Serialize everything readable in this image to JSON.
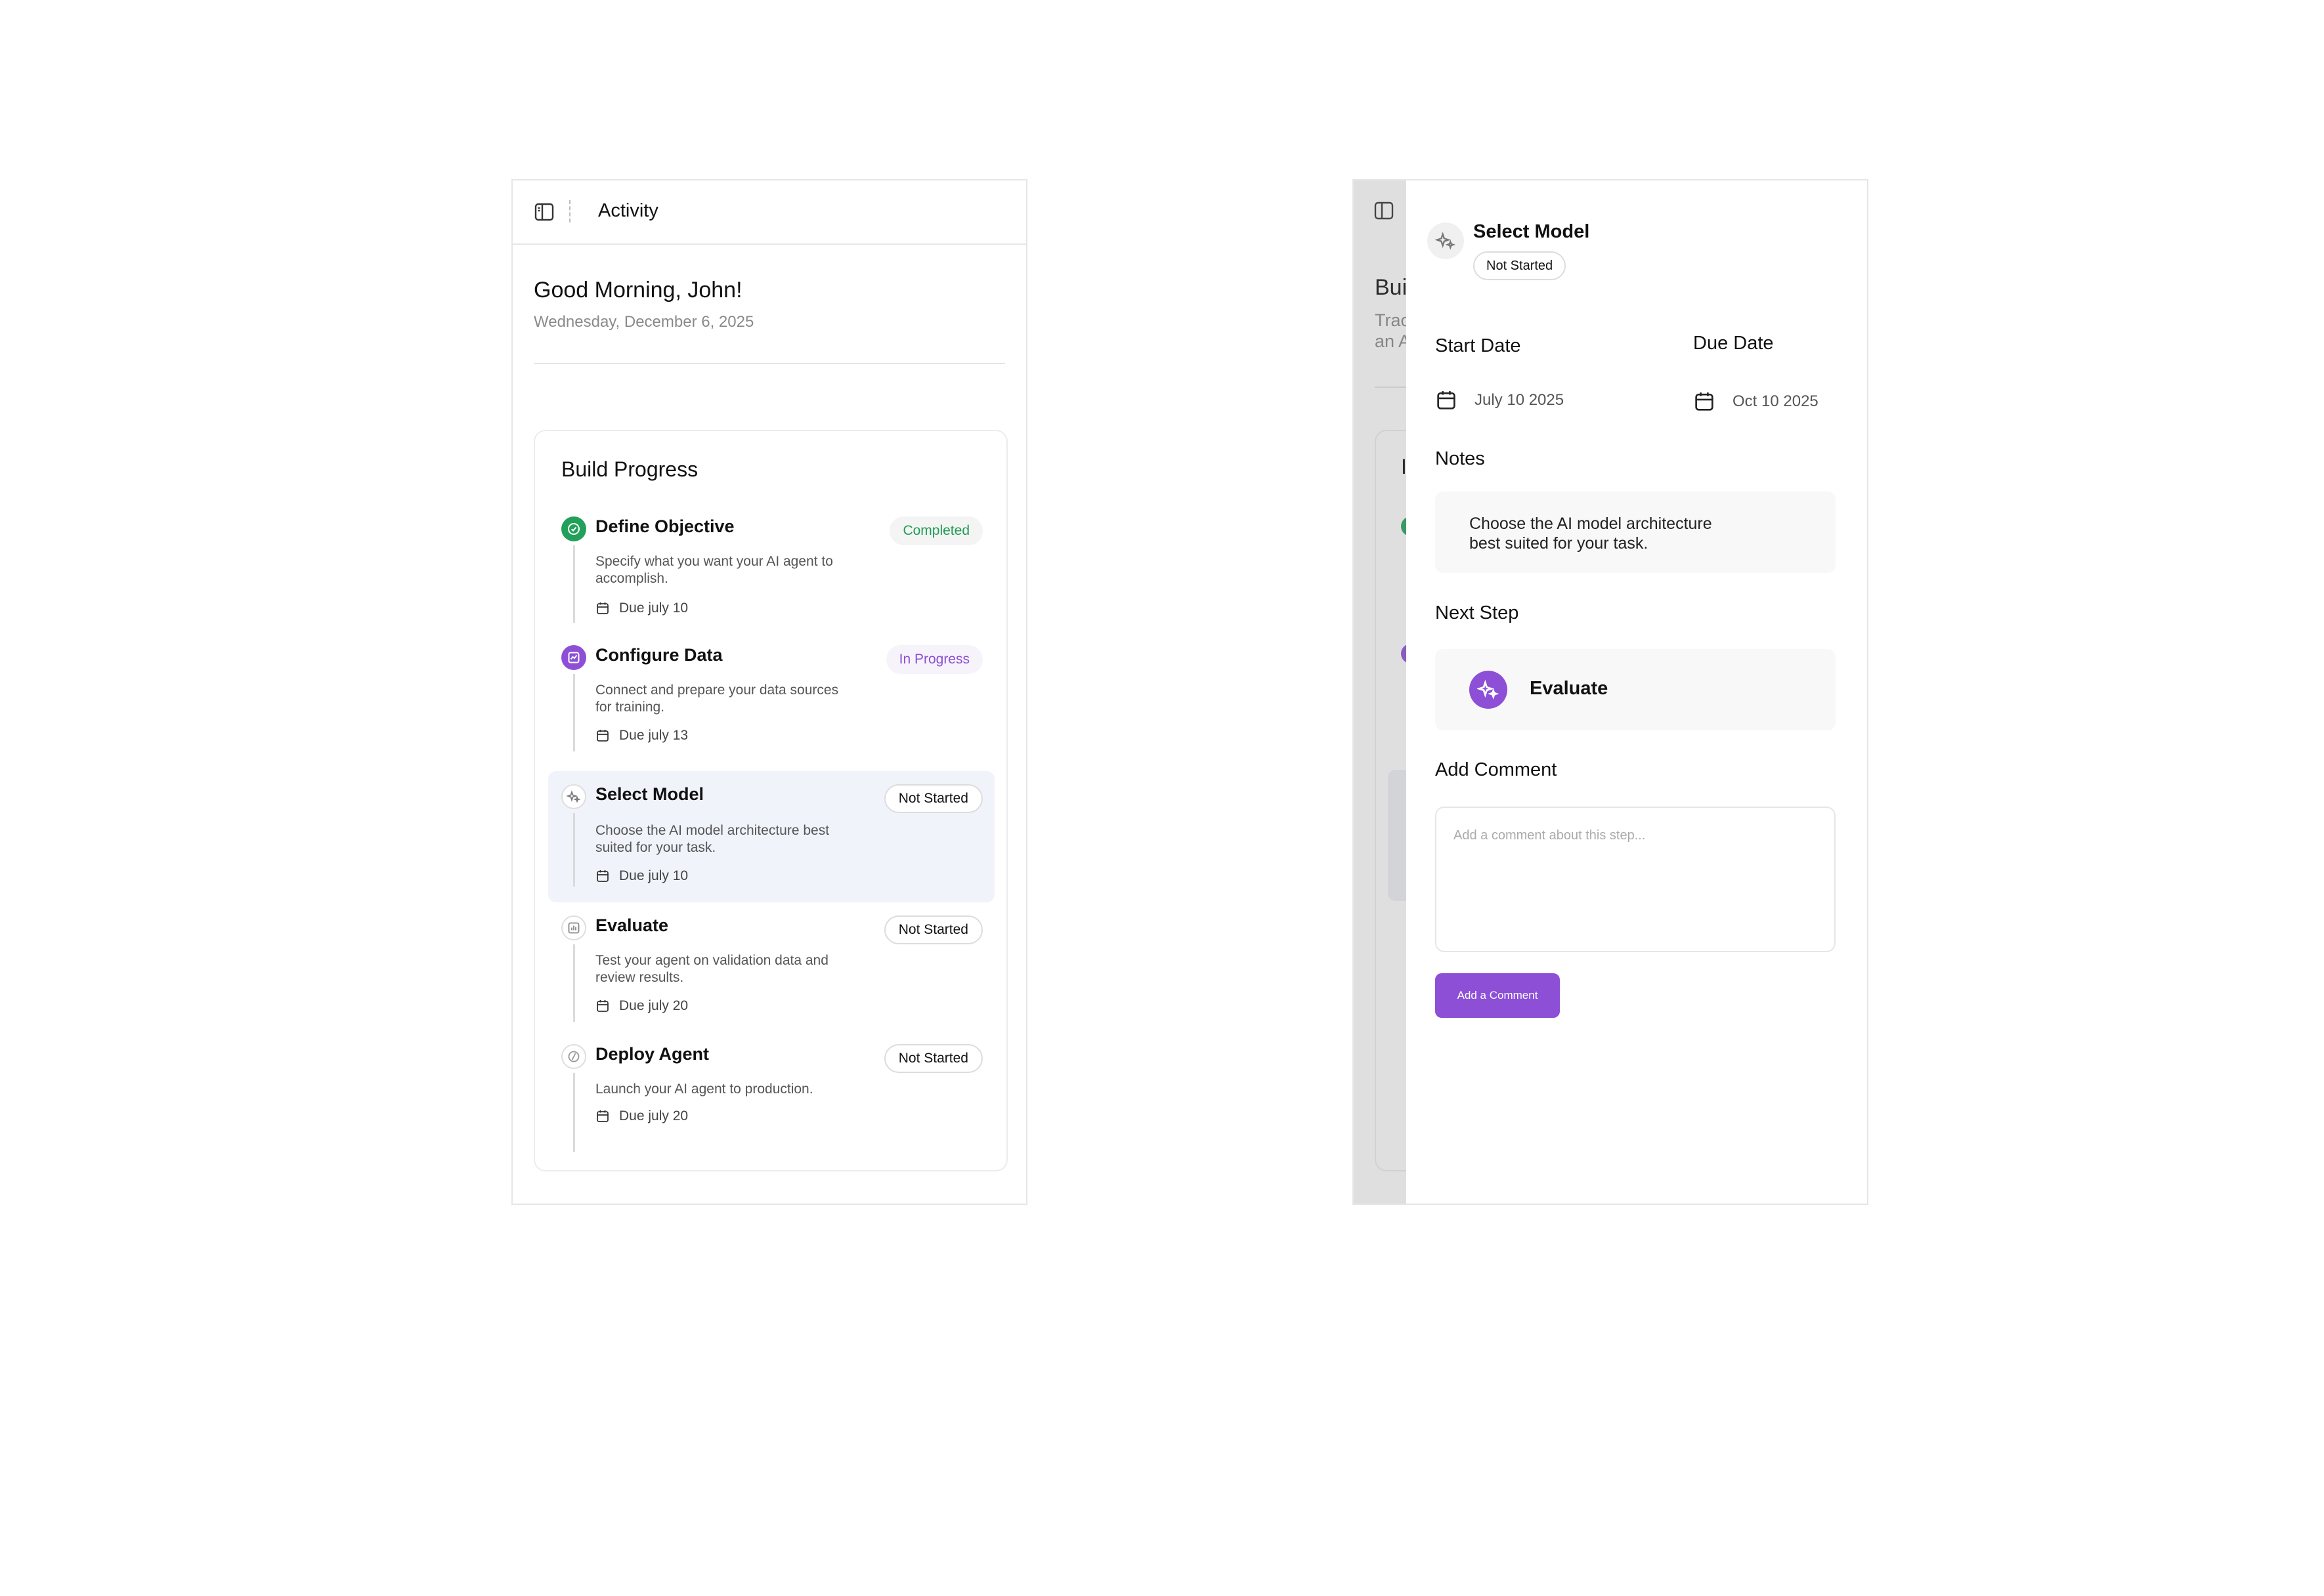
{
  "activity_panel": {
    "header": {
      "title": "Activity",
      "toggle_icon": "sidebar-panel-icon"
    },
    "greeting": "Good Morning, John!",
    "date": "Wednesday, December 6, 2025",
    "build_progress": {
      "title": "Build Progress",
      "steps": [
        {
          "title": "Define Objective",
          "description": "Specify what you want your AI agent to accomplish.",
          "due": "Due july 10",
          "status": "Completed",
          "icon": "check-circle-icon"
        },
        {
          "title": "Configure Data",
          "description": "Connect and prepare your data sources for training.",
          "due": "Due july 13",
          "status": "In Progress",
          "icon": "chart-box-icon"
        },
        {
          "title": "Select Model",
          "description": "Choose the AI model architecture best suited for your task.",
          "due": "Due july 10",
          "status": "Not Started",
          "icon": "sparkles-icon"
        },
        {
          "title": "Evaluate",
          "description": "Test your agent on validation data and review results.",
          "due": "Due july 20",
          "status": "Not Started",
          "icon": "bar-chart-icon"
        },
        {
          "title": "Deploy Agent",
          "description": "Launch your AI agent to production.",
          "due": "Due july 20",
          "status": "Not Started",
          "icon": "slash-circle-icon"
        }
      ]
    }
  },
  "detail_panel": {
    "background_fragments": {
      "heading": "Bui",
      "subtitle_line1": "Trac",
      "subtitle_line2": "an A",
      "card_letter": "I"
    },
    "step_title": "Select Model",
    "status": "Not Started",
    "start_date": {
      "label": "Start Date",
      "value": "July 10 2025"
    },
    "due_date": {
      "label": "Due Date",
      "value": "Oct 10 2025"
    },
    "notes": {
      "label": "Notes",
      "text": "Choose the AI model architecture best suited for your task."
    },
    "next_step": {
      "label": "Next Step",
      "name": "Evaluate"
    },
    "comment": {
      "label": "Add Comment",
      "value": "",
      "placeholder": "Add a comment about this step...",
      "button_label": "Add a Comment"
    }
  },
  "colors": {
    "accent_purple": "#8c4fd6",
    "success_green": "#22a05a",
    "highlight_row": "#f1f3fb",
    "border": "#e6e6e6"
  }
}
